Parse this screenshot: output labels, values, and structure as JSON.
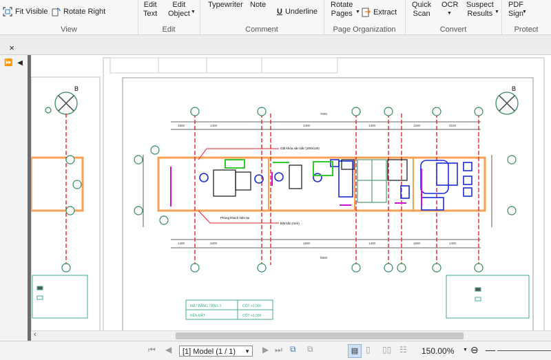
{
  "ribbon": {
    "view": {
      "label": "View",
      "fit_visible": "Fit Visible",
      "rotate_right": "Rotate Right"
    },
    "edit": {
      "label": "Edit",
      "edit_text": "Edit\nText",
      "edit_object": "Edit\nObject"
    },
    "comment": {
      "label": "Comment",
      "typewriter": "Typewriter",
      "note": "Note",
      "underline": "Underline"
    },
    "page_org": {
      "label": "Page Organization",
      "rotate_pages": "Rotate\nPages",
      "extract": "Extract"
    },
    "convert": {
      "label": "Convert",
      "quick_scan": "Quick\nScan",
      "ocr": "OCR",
      "suspect_results": "Suspect\nResults"
    },
    "protect": {
      "label": "Protect",
      "pdf_sign": "PDF\nSign"
    }
  },
  "tab": {
    "close_glyph": "×"
  },
  "nav": {
    "expand_glyph": "⏩",
    "collapse_glyph": "◀"
  },
  "drawing": {
    "labels": [
      "1800",
      "1400",
      "2400",
      "1400",
      "1200",
      "3100",
      "1400",
      "1000",
      "1600",
      "1400",
      "1600",
      "1400",
      "2200",
      "2100",
      "2500",
      "1150",
      "3150",
      "1100",
      "7050",
      "B",
      "B",
      "5900",
      "2200",
      "6550"
    ],
    "note1": "Gặt khóa sân bắc (300x120)",
    "note2": "Phòng khách hiện tại",
    "note3": "Đặt bồn (mới)",
    "legend_left_title": "MẶT BẰNG TẦNG 1",
    "legend_left_sub": "NỀN ĐẤT",
    "legend_right1": "CỐT +0.000",
    "legend_right2": "CỐT +0.000"
  },
  "status": {
    "page_select": "[1] Model (1 / 1)",
    "zoom": "150.00%",
    "zoom_minus": "⊖",
    "zoom_dash": "—"
  },
  "colors": {
    "wall": "#f5a255",
    "grid_line": "#e8202a",
    "axis_circle": "#2e8b57",
    "furniture": "#1a2bd6",
    "green": "#31c92e",
    "magenta": "#d10ed1",
    "legend": "#3fae80"
  }
}
